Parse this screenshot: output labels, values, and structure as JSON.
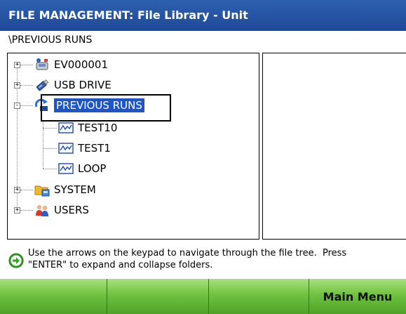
{
  "window": {
    "title": "FILE MANAGEMENT: File Library - Unit"
  },
  "path": "\\PREVIOUS RUNS",
  "tree": {
    "nodes": [
      {
        "label": "EV000001",
        "icon": "device-icon",
        "expander": "+"
      },
      {
        "label": "USB DRIVE",
        "icon": "usb-drive-icon",
        "expander": "+"
      },
      {
        "label": "PREVIOUS RUNS",
        "icon": "previous-runs-icon",
        "expander": "-",
        "selected": true
      },
      {
        "label": "TEST10",
        "icon": "waveform-file-icon"
      },
      {
        "label": "TEST1",
        "icon": "waveform-file-icon"
      },
      {
        "label": "LOOP",
        "icon": "waveform-file-icon"
      },
      {
        "label": "SYSTEM",
        "icon": "system-folder-icon",
        "expander": "+"
      },
      {
        "label": "USERS",
        "icon": "users-icon",
        "expander": "+"
      }
    ]
  },
  "hint": {
    "icon": "green-arrow-icon",
    "text": "Use the arrows on the keypad to navigate through the file tree.  Press\n\"ENTER\" to expand and collapse folders."
  },
  "softkeys": [
    "",
    "",
    "",
    "Main Menu"
  ],
  "colors": {
    "titlebar": "#1e4a98",
    "selection": "#1e56c8",
    "softkey": "#6fc23f"
  }
}
